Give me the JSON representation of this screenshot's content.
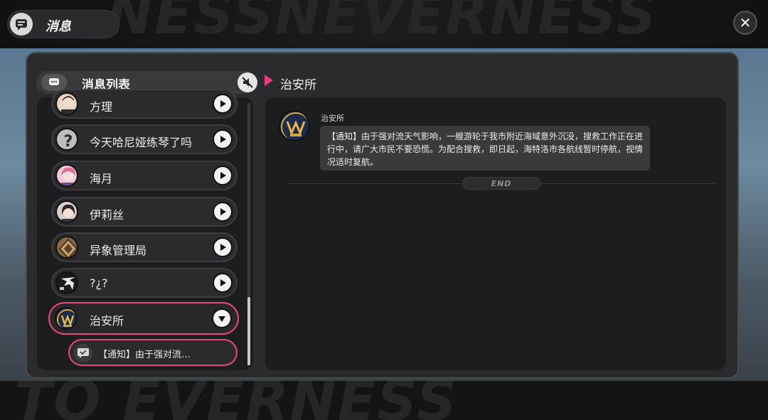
{
  "window": {
    "title": "消息"
  },
  "list_header": {
    "title": "消息列表"
  },
  "breadcrumb": {
    "current": "治安所"
  },
  "contacts": [
    {
      "name": "方理",
      "avatar": "avatar-person-1"
    },
    {
      "name": "今天哈尼娅练琴了吗",
      "avatar": "question-mark-avatar"
    },
    {
      "name": "海月",
      "avatar": "avatar-pink-hair"
    },
    {
      "name": "伊莉丝",
      "avatar": "avatar-dark-hair"
    },
    {
      "name": "异象管理局",
      "avatar": "bureau-emblem"
    },
    {
      "name": "?¿?",
      "avatar": "glitch-avatar"
    },
    {
      "name": "治安所",
      "avatar": "police-emblem",
      "selected": true
    }
  ],
  "sub_message": {
    "preview": "【通知】由于强对流…"
  },
  "chat": {
    "sender": "治安所",
    "message": "【通知】由于强对流天气影响，一艘游轮于我市附近海域意外沉没，搜救工作正在进行中，请广大市民不要恐慌。为配合搜救，即日起，海特洛市各航线暂时停航，视情况适时复航。",
    "end_label": "END"
  },
  "colors": {
    "accent": "#e8487f",
    "panel": "#1d1d1f",
    "window": "#2b2b2d"
  }
}
